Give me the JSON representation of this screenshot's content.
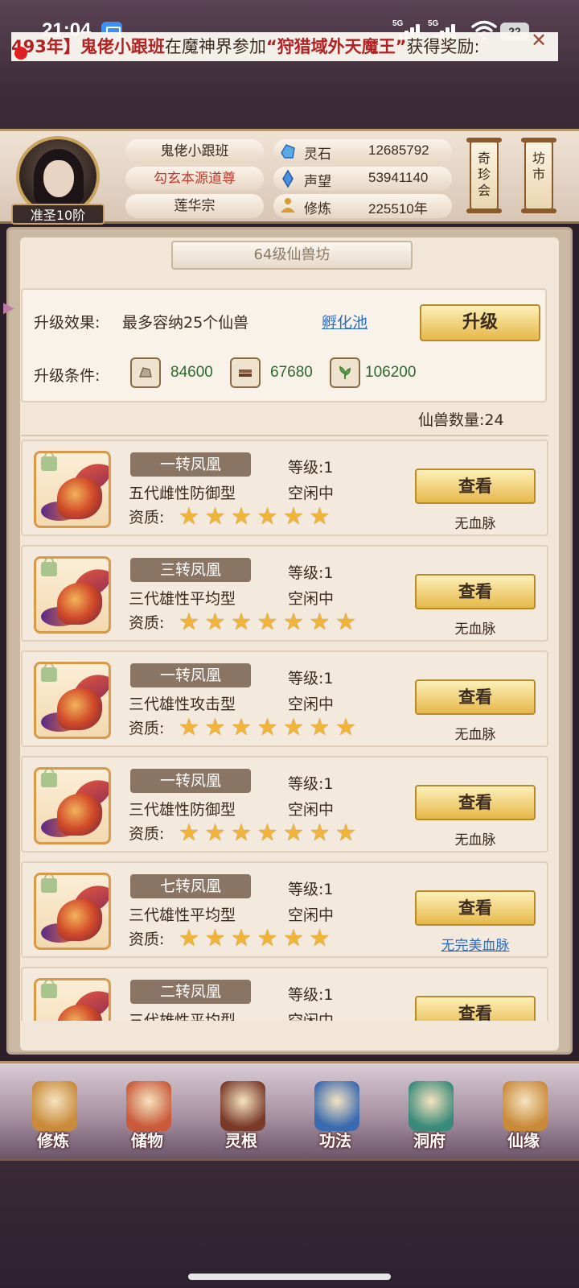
{
  "status_bar": {
    "time": "21:04",
    "signal1": "5G",
    "signal2": "5G",
    "battery": "22"
  },
  "player": {
    "rank": "准圣10阶",
    "name": "鬼佬小跟班",
    "title": "勾玄本源道尊",
    "sect": "莲华宗"
  },
  "resources": [
    {
      "label": "灵石",
      "value": "12685792",
      "icon": "spirit-stone-icon",
      "color": "#4a8fd6"
    },
    {
      "label": "声望",
      "value": "53941140",
      "icon": "prestige-crystal-icon",
      "color": "#3a7fd0"
    },
    {
      "label": "修炼",
      "value": "225510年",
      "icon": "meditation-icon",
      "color": "#d79b3a"
    }
  ],
  "header_buttons": {
    "treasure": "奇珍会",
    "market": "坊市"
  },
  "shop": {
    "title": "64级仙兽坊",
    "marquee_prefix": "493年】",
    "marquee_player": "鬼佬小跟班",
    "marquee_mid": "在魔神界参加",
    "marquee_event": "“狩猎域外天魔王”",
    "marquee_suffix": "获得奖励:",
    "upgrade_effect_label": "升级效果:",
    "upgrade_effect_value": "最多容纳25个仙兽",
    "hatch_link": "孵化池",
    "upgrade_button": "升级",
    "upgrade_cond_label": "升级条件:",
    "materials": [
      {
        "icon": "ore-icon",
        "value": "84600"
      },
      {
        "icon": "wood-icon",
        "value": "67680"
      },
      {
        "icon": "herb-icon",
        "value": "106200"
      }
    ],
    "beast_count_label": "仙兽数量:",
    "beast_count": "24",
    "level_label": "等级:",
    "aptitude_label": "资质:",
    "view_button": "查看"
  },
  "beasts": [
    {
      "name": "一转凤凰",
      "level": "1",
      "desc": "五代雌性防御型",
      "status": "空闲中",
      "stars": 6,
      "bloodline": "无血脉",
      "bloodline_link": false
    },
    {
      "name": "三转凤凰",
      "level": "1",
      "desc": "三代雄性平均型",
      "status": "空闲中",
      "stars": 7,
      "bloodline": "无血脉",
      "bloodline_link": false
    },
    {
      "name": "一转凤凰",
      "level": "1",
      "desc": "三代雄性攻击型",
      "status": "空闲中",
      "stars": 7,
      "bloodline": "无血脉",
      "bloodline_link": false
    },
    {
      "name": "一转凤凰",
      "level": "1",
      "desc": "三代雄性防御型",
      "status": "空闲中",
      "stars": 7,
      "bloodline": "无血脉",
      "bloodline_link": false
    },
    {
      "name": "七转凤凰",
      "level": "1",
      "desc": "三代雄性平均型",
      "status": "空闲中",
      "stars": 6,
      "bloodline": "无完美血脉",
      "bloodline_link": true
    },
    {
      "name": "二转凤凰",
      "level": "1",
      "desc": "三代雄性平均型",
      "status": "空闲中",
      "stars": 0,
      "bloodline": "",
      "bloodline_link": false
    }
  ],
  "bottom_nav": [
    {
      "label": "修炼",
      "icon": "cultivation-icon",
      "color": "#c98a3a"
    },
    {
      "label": "储物",
      "icon": "storage-bag-icon",
      "color": "#c95a3a"
    },
    {
      "label": "灵根",
      "icon": "spirit-root-icon",
      "color": "#7a3a2a"
    },
    {
      "label": "功法",
      "icon": "technique-book-icon",
      "color": "#3a6ab0"
    },
    {
      "label": "洞府",
      "icon": "cave-mansion-icon",
      "color": "#3a8a7a"
    },
    {
      "label": "仙缘",
      "icon": "fortune-gourd-icon",
      "color": "#c98a3a"
    }
  ]
}
